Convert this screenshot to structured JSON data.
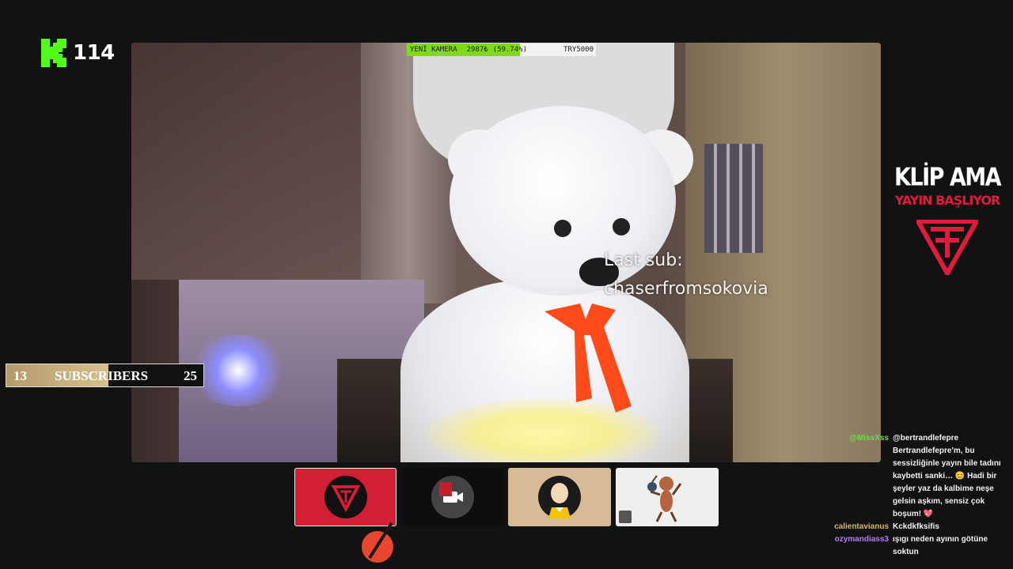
{
  "kick": {
    "viewer_count": "114",
    "brand_color": "#53fc18"
  },
  "donation_bar": {
    "label": "YENİ KAMERA",
    "amount": "2987₺",
    "percent_text": "(59.74%)",
    "goal": "TRY5000",
    "progress": 0.5974
  },
  "last_sub": {
    "title": "Last sub:",
    "name": "chaserfromsokovia"
  },
  "sub_goal": {
    "current": "13",
    "label": "SUBSCRIBERS",
    "target": "25",
    "progress": 0.52
  },
  "promo": {
    "line1": "KLİP AMA",
    "line2": "YAYIN BAŞLIYOR",
    "accent": "#e01c3c"
  },
  "participants": [
    {
      "name": "logo-tile",
      "bg": "#d21f34"
    },
    {
      "name": "camera-off-tile",
      "bg": "#0e0e0e"
    },
    {
      "name": "saitama-tile",
      "bg": "#d7bb96"
    },
    {
      "name": "ant-tile",
      "bg": "#efefef"
    }
  ],
  "chat": [
    {
      "user": "@MissXss",
      "color": "#6ddc4a",
      "text": "@bertrandlefepre Bertrandlefepre'm, bu sessizliğinle yayın bile tadını kaybetti sanki… 😊 Hadi bir şeyler yaz da kalbime neşe gelsin aşkım, sensiz çok boşum! 💖"
    },
    {
      "user": "calientavianus",
      "color": "#d9b56a",
      "text": "Kckdkfksifis"
    },
    {
      "user": "ozymandiass3",
      "color": "#b57bf0",
      "text": "ışıgı neden ayının götüne soktun"
    }
  ]
}
